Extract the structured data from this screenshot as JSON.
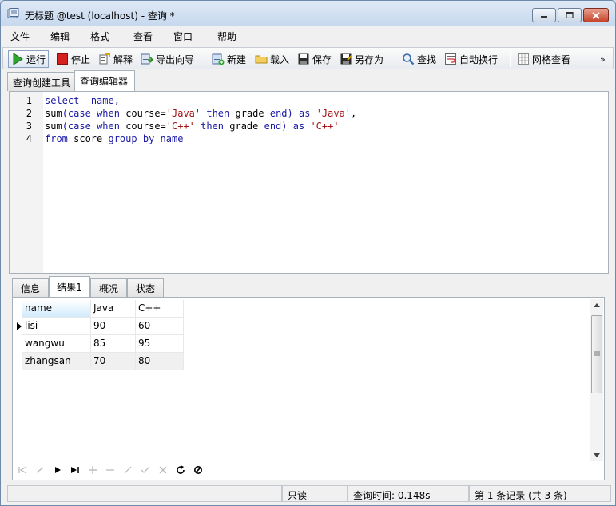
{
  "window": {
    "title": "无标题 @test (localhost) - 查询 *"
  },
  "menu": [
    "文件",
    "编辑",
    "格式",
    "查看",
    "窗口",
    "帮助"
  ],
  "toolbar": {
    "run": "运行",
    "stop": "停止",
    "explain": "解释",
    "export_wizard": "导出向导",
    "new": "新建",
    "load": "载入",
    "save": "保存",
    "save_as": "另存为",
    "find": "查找",
    "word_wrap": "自动换行",
    "grid_view": "网格查看",
    "more": "»"
  },
  "editor_tabs": [
    "查询创建工具",
    "查询编辑器"
  ],
  "editor": {
    "lines": [
      {
        "no": "1",
        "tokens": [
          [
            "kw",
            "select"
          ],
          [
            "plain",
            "  "
          ],
          [
            "kw",
            "name,"
          ]
        ]
      },
      {
        "no": "2",
        "tokens": [
          [
            "plain",
            "sum"
          ],
          [
            "kw",
            "("
          ],
          [
            "kw",
            "case"
          ],
          [
            "plain",
            " "
          ],
          [
            "kw",
            "when"
          ],
          [
            "plain",
            " course="
          ],
          [
            "str",
            "'Java'"
          ],
          [
            "plain",
            " "
          ],
          [
            "kw",
            "then"
          ],
          [
            "plain",
            " grade "
          ],
          [
            "kw",
            "end"
          ],
          [
            "kw",
            ")"
          ],
          [
            "plain",
            " "
          ],
          [
            "kw",
            "as"
          ],
          [
            "plain",
            " "
          ],
          [
            "str",
            "'Java'"
          ],
          [
            "plain",
            ","
          ]
        ]
      },
      {
        "no": "3",
        "tokens": [
          [
            "plain",
            "sum"
          ],
          [
            "kw",
            "("
          ],
          [
            "kw",
            "case"
          ],
          [
            "plain",
            " "
          ],
          [
            "kw",
            "when"
          ],
          [
            "plain",
            " course="
          ],
          [
            "str",
            "'C++'"
          ],
          [
            "plain",
            " "
          ],
          [
            "kw",
            "then"
          ],
          [
            "plain",
            " grade "
          ],
          [
            "kw",
            "end"
          ],
          [
            "kw",
            ")"
          ],
          [
            "plain",
            " "
          ],
          [
            "kw",
            "as"
          ],
          [
            "plain",
            " "
          ],
          [
            "str",
            "'C++'"
          ]
        ]
      },
      {
        "no": "4",
        "tokens": [
          [
            "kw",
            "from"
          ],
          [
            "plain",
            " score "
          ],
          [
            "kw",
            "group"
          ],
          [
            "plain",
            " "
          ],
          [
            "kw",
            "by"
          ],
          [
            "plain",
            " "
          ],
          [
            "kw",
            "name"
          ]
        ]
      }
    ]
  },
  "result_tabs": [
    "信息",
    "结果1",
    "概况",
    "状态"
  ],
  "grid": {
    "columns": [
      "name",
      "Java",
      "C++"
    ],
    "rows": [
      [
        "lisi",
        "90",
        "60"
      ],
      [
        "wangwu",
        "85",
        "95"
      ],
      [
        "zhangsan",
        "70",
        "80"
      ]
    ]
  },
  "status": {
    "readonly": "只读",
    "query_time": "查询时间: 0.148s",
    "record_info": "第 1 条记录 (共 3 条)"
  }
}
